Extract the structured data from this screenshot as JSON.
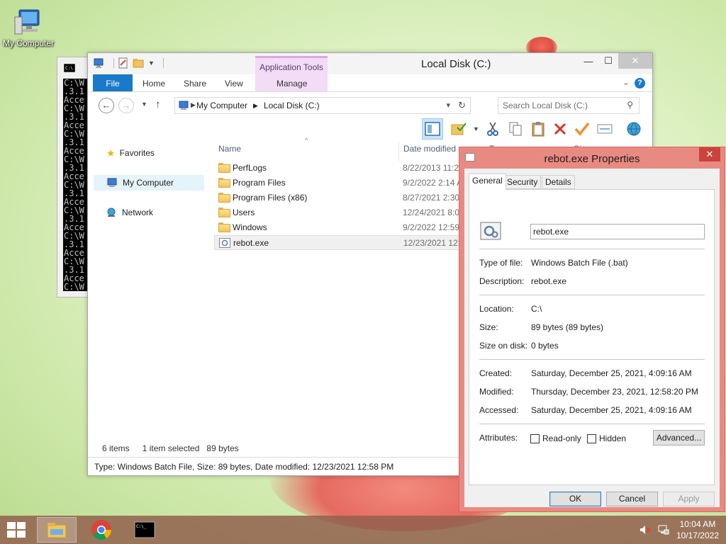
{
  "desktop": {
    "icon_label": "My Computer"
  },
  "cmd": {
    "lines": "C:\\W\n.3.1\nAcce\nC:\\W\n.3.1\nAcce\nC:\\W\n.3.1\nAcce\nC:\\W\n.3.1\nAcce\nC:\\W\n.3.1\nAcce\nC:\\W\n.3.1\nAcce\nC:\\W\n.3.1\nAcce\nC:\\W\n.3.1\nAcce\nC:\\W\n.3.1\nAcce"
  },
  "explorer": {
    "title": "Local Disk (C:)",
    "contextual_tab": "Application Tools",
    "tabs": {
      "file": "File",
      "home": "Home",
      "share": "Share",
      "view": "View",
      "manage": "Manage"
    },
    "address": {
      "crumb1": "My Computer",
      "crumb2": "Local Disk (C:)"
    },
    "search_placeholder": "Search Local Disk (C:)",
    "nav": {
      "favorites": "Favorites",
      "computer": "My Computer",
      "network": "Network"
    },
    "columns": {
      "name": "Name",
      "date": "Date modified",
      "type": "Type",
      "size": "Size"
    },
    "files": [
      {
        "name": "PerfLogs",
        "date": "8/22/2013 11:22 AM",
        "kind": "folder"
      },
      {
        "name": "Program Files",
        "date": "9/2/2022 2:14 AM",
        "kind": "folder"
      },
      {
        "name": "Program Files (x86)",
        "date": "8/27/2021 2:30 PM",
        "kind": "folder"
      },
      {
        "name": "Users",
        "date": "12/24/2021 8:09 AM",
        "kind": "folder"
      },
      {
        "name": "Windows",
        "date": "9/2/2022 12:59 PM",
        "kind": "folder"
      },
      {
        "name": "rebot.exe",
        "date": "12/23/2021 12:58 PM",
        "kind": "bat"
      }
    ],
    "status": {
      "count": "6 items",
      "selected": "1 item selected",
      "size": "89 bytes",
      "details": "Type: Windows Batch File, Size: 89 bytes, Date modified: 12/23/2021 12:58 PM"
    }
  },
  "properties": {
    "title": "rebot.exe Properties",
    "tabs": {
      "general": "General",
      "security": "Security",
      "details": "Details"
    },
    "filename": "rebot.exe",
    "labels": {
      "type": "Type of file:",
      "description": "Description:",
      "location": "Location:",
      "size": "Size:",
      "size_on_disk": "Size on disk:",
      "created": "Created:",
      "modified": "Modified:",
      "accessed": "Accessed:",
      "attributes": "Attributes:"
    },
    "values": {
      "type": "Windows Batch File (.bat)",
      "description": "rebot.exe",
      "location": "C:\\",
      "size": "89 bytes (89 bytes)",
      "size_on_disk": "0 bytes",
      "created": "Saturday, December 25, 2021, 4:09:16 AM",
      "modified": "Thursday, December 23, 2021, 12:58:20 PM",
      "accessed": "Saturday, December 25, 2021, 4:09:16 AM"
    },
    "attrs": {
      "readonly": "Read-only",
      "hidden": "Hidden",
      "advanced": "Advanced..."
    },
    "buttons": {
      "ok": "OK",
      "cancel": "Cancel",
      "apply": "Apply"
    }
  },
  "taskbar": {
    "time": "10:04 AM",
    "date": "10/17/2022"
  }
}
